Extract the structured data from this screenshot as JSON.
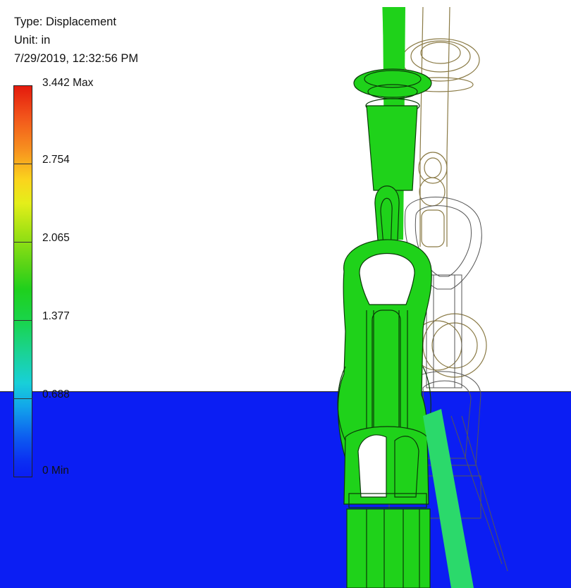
{
  "legend": {
    "type_line": "Type: Displacement",
    "unit_line": "Unit: in",
    "timestamp": "7/29/2019, 12:32:56 PM"
  },
  "colorbar": {
    "labels": [
      "3.442 Max",
      "2.754",
      "2.065",
      "1.377",
      "0.688",
      "0 Min"
    ],
    "max": 3.442,
    "min": 0,
    "colors": [
      "#e41a0d",
      "#f7921f",
      "#fbd41d",
      "#58d416",
      "#1fd01c",
      "#1ad392",
      "#18d0d8",
      "#0d5cf0",
      "#0a1ef3"
    ]
  },
  "scene": {
    "background_color": "#ffffff",
    "water_color": "#0b1ef3",
    "deformed_mesh_color": "#1fd21a",
    "original_outline_color": "#8a7a45"
  }
}
